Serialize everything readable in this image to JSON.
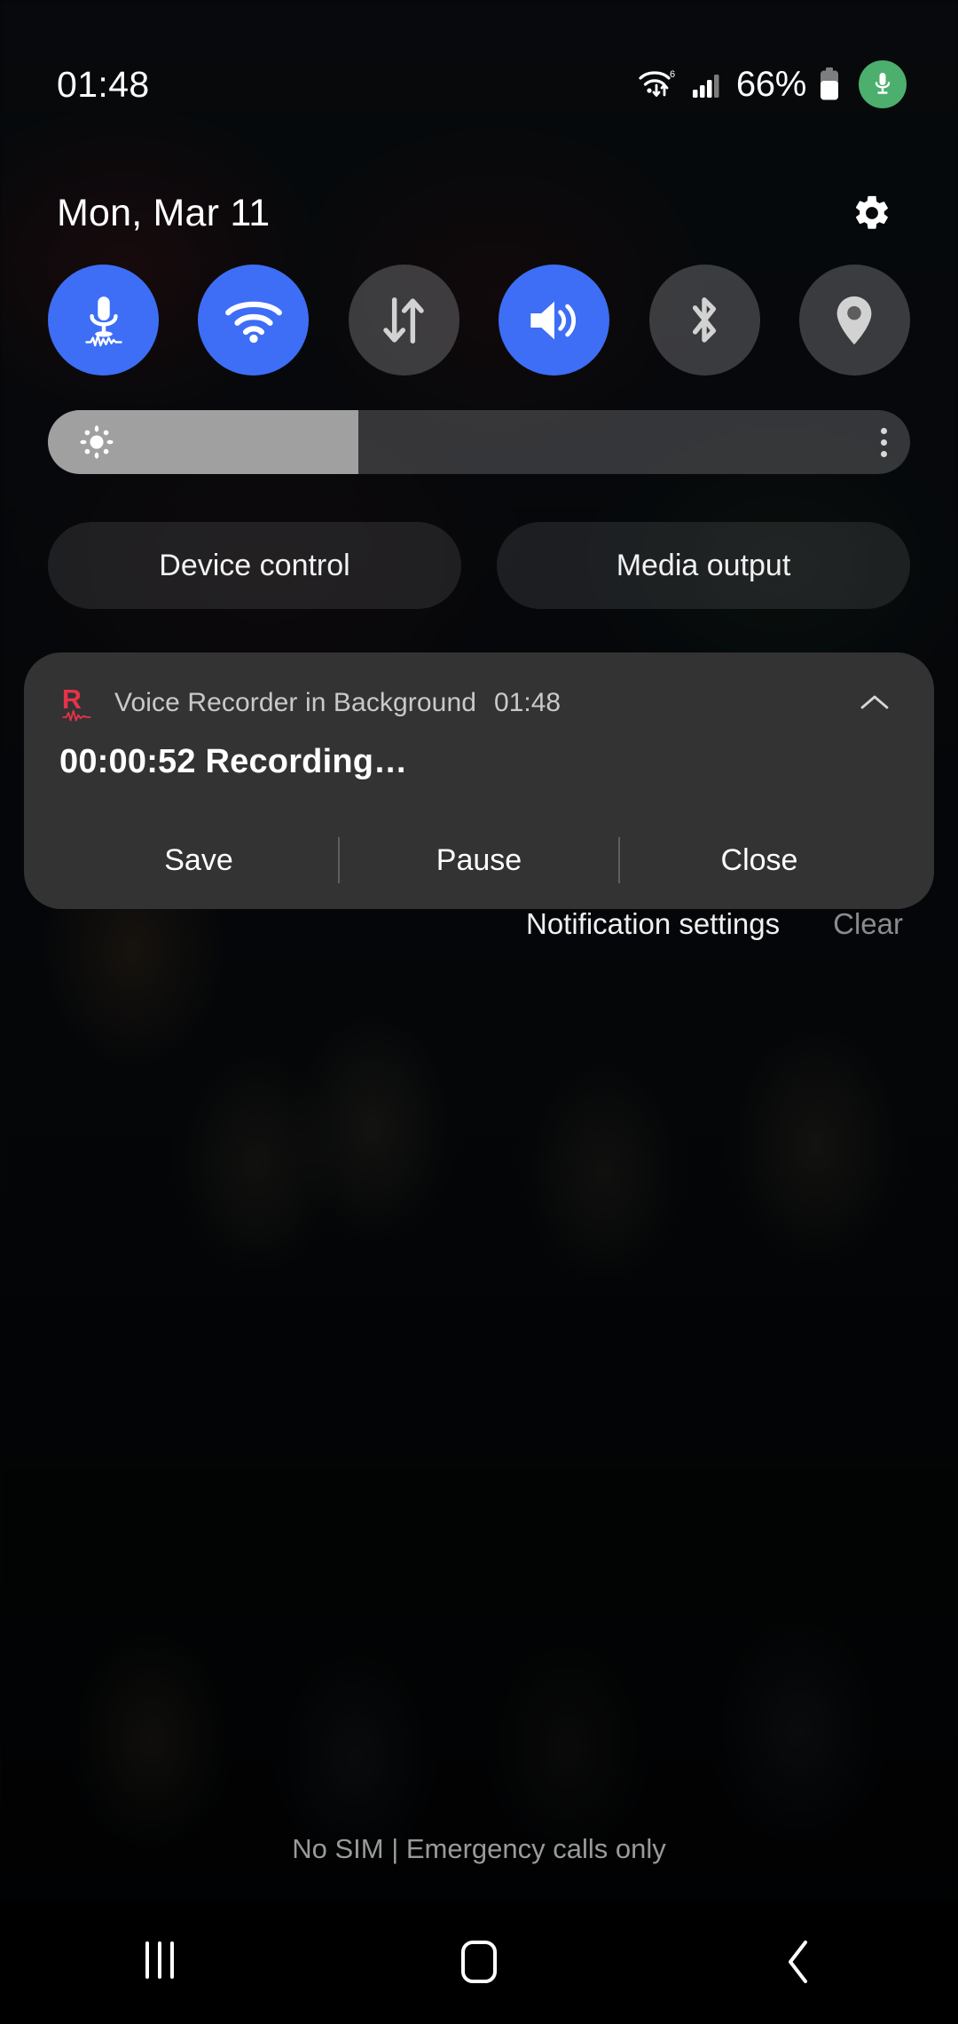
{
  "status_bar": {
    "clock": "01:48",
    "battery_percent": "66%",
    "icons": [
      "wifi-6-icon",
      "signal-bars-icon",
      "battery-icon",
      "mic-recording-indicator-icon"
    ]
  },
  "header": {
    "date": "Mon, Mar 11",
    "settings_icon": "gear-icon"
  },
  "quick_settings": {
    "tiles": [
      {
        "name": "microphone",
        "icon": "microphone-icon",
        "state": "on"
      },
      {
        "name": "wifi",
        "icon": "wifi-icon",
        "state": "on"
      },
      {
        "name": "mobile-data",
        "icon": "data-transfer-icon",
        "state": "off"
      },
      {
        "name": "sound",
        "icon": "speaker-icon",
        "state": "on"
      },
      {
        "name": "bluetooth",
        "icon": "bluetooth-icon",
        "state": "off"
      },
      {
        "name": "location",
        "icon": "location-pin-icon",
        "state": "off"
      }
    ],
    "brightness": {
      "icon": "brightness-sun-icon",
      "value_percent": 36,
      "menu_icon": "overflow-menu-icon"
    },
    "buttons": {
      "device_control": "Device control",
      "media_output": "Media output"
    }
  },
  "notification": {
    "app_icon": "voice-recorder-icon",
    "app_name": "Voice Recorder in Background",
    "time": "01:48",
    "collapse_icon": "chevron-up-icon",
    "title": "00:00:52 Recording…",
    "actions": [
      "Save",
      "Pause",
      "Close"
    ]
  },
  "notification_footer": {
    "settings_label": "Notification settings",
    "clear_label": "Clear"
  },
  "carrier": "No SIM | Emergency calls only",
  "nav_bar": {
    "recents": "recents-icon",
    "home": "home-icon",
    "back": "back-icon"
  },
  "colors": {
    "accent_on": "#3d6ef5",
    "tile_off": "#848488",
    "card_bg": "#333333",
    "recording_green": "#4caf6d",
    "app_red": "#e5334a"
  }
}
